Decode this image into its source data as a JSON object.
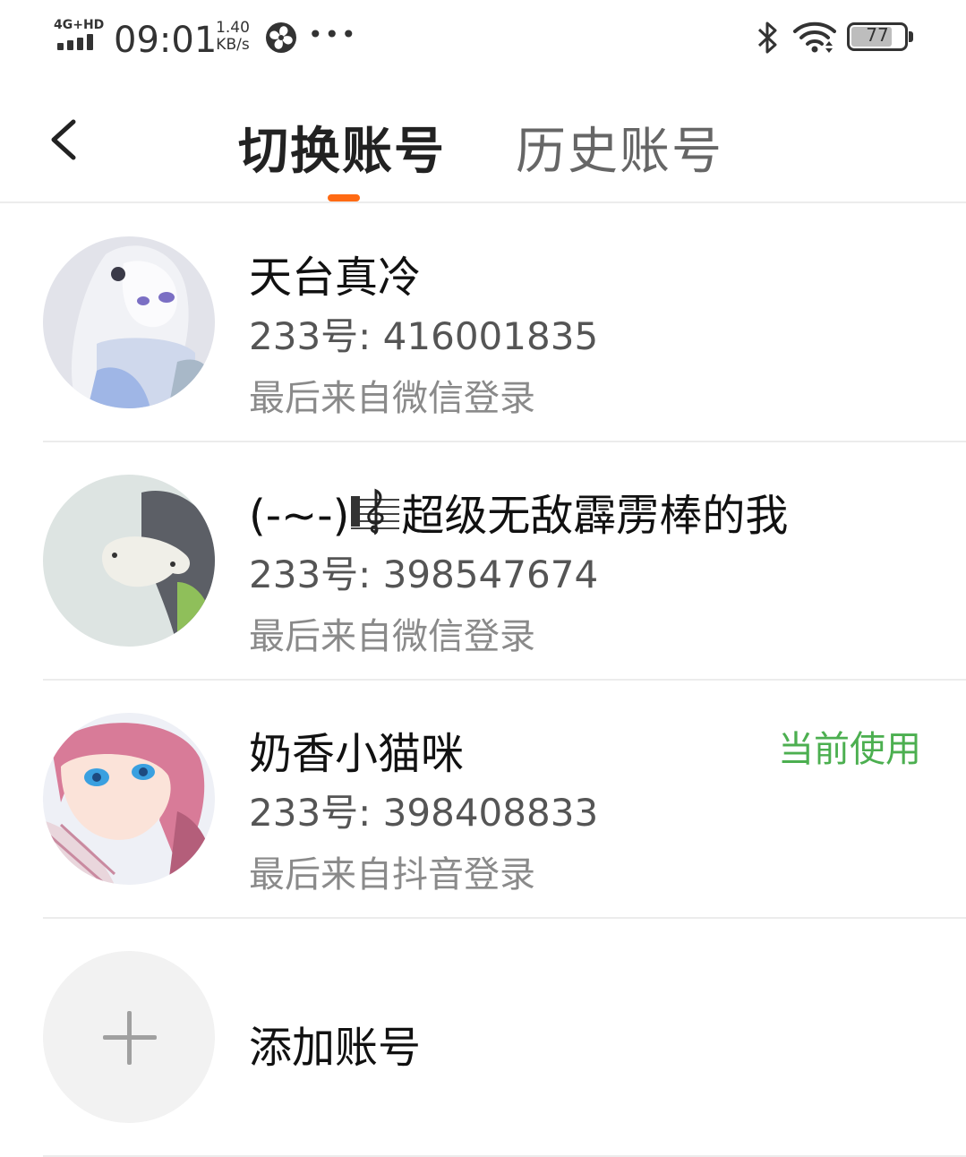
{
  "status_bar": {
    "network": "4G+HD",
    "time": "09:01",
    "speed_value": "1.40",
    "speed_unit": "KB/s",
    "more": "•••",
    "battery": "77",
    "battery_level_percent": 77,
    "icons": [
      "signal-icon",
      "fan-icon",
      "bluetooth-icon",
      "wifi-icon",
      "battery-icon"
    ]
  },
  "header": {
    "back_icon": "chevron-left-icon",
    "tabs": [
      {
        "label": "切换账号",
        "active": true
      },
      {
        "label": "历史账号",
        "active": false
      }
    ],
    "accent_color": "#ff6a13"
  },
  "accounts": [
    {
      "name": "天台真冷",
      "id_line": "233号: 416001835",
      "login": "最后来自微信登录",
      "current": false
    },
    {
      "name_prefix": "(-~-)",
      "name_icon": "treble-clef-icon",
      "name_suffix": "超级无敌霹雳棒的我",
      "id_line": "233号: 398547674",
      "login": "最后来自微信登录",
      "current": false
    },
    {
      "name": "奶香小猫咪",
      "id_line": "233号: 398408833",
      "login": "最后来自抖音登录",
      "current": true,
      "current_label": "当前使用",
      "current_color": "#4caf50"
    }
  ],
  "add_account": {
    "label": "添加账号",
    "icon": "plus-icon"
  }
}
